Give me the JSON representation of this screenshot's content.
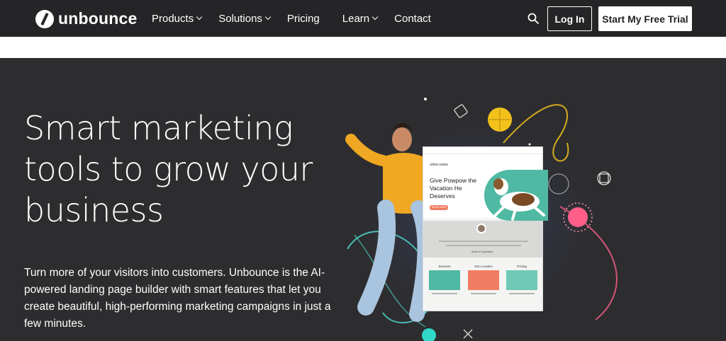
{
  "brand": {
    "name": "unbounce"
  },
  "nav": {
    "items": [
      {
        "label": "Products",
        "dropdown": true
      },
      {
        "label": "Solutions",
        "dropdown": true
      },
      {
        "label": "Pricing",
        "dropdown": false
      },
      {
        "label": "Learn",
        "dropdown": true
      },
      {
        "label": "Contact",
        "dropdown": false
      }
    ],
    "login_label": "Log In",
    "trial_label": "Start My Free Trial"
  },
  "hero": {
    "headline": "Smart marketing tools to grow your business",
    "subtext": "Turn more of your visitors into customers. Unbounce is the AI-powered landing page builder with smart features that let you create beautiful, high-performing marketing campaigns in just a few minutes."
  },
  "preview_card": {
    "logo": "urban paws",
    "title": "Give Powpow the Vacation He Deserves",
    "button": "BOOK NOW",
    "mid_caption": "Some & Dog Name",
    "columns": [
      "Services",
      "Our Location",
      "Pricing"
    ]
  },
  "colors": {
    "nav_bg": "#252527",
    "hero_bg": "#2d2d2f",
    "accent_yellow": "#f2c21b",
    "accent_teal": "#4fb9a3",
    "accent_coral": "#f07d63",
    "accent_pink": "#ff5e8a"
  }
}
